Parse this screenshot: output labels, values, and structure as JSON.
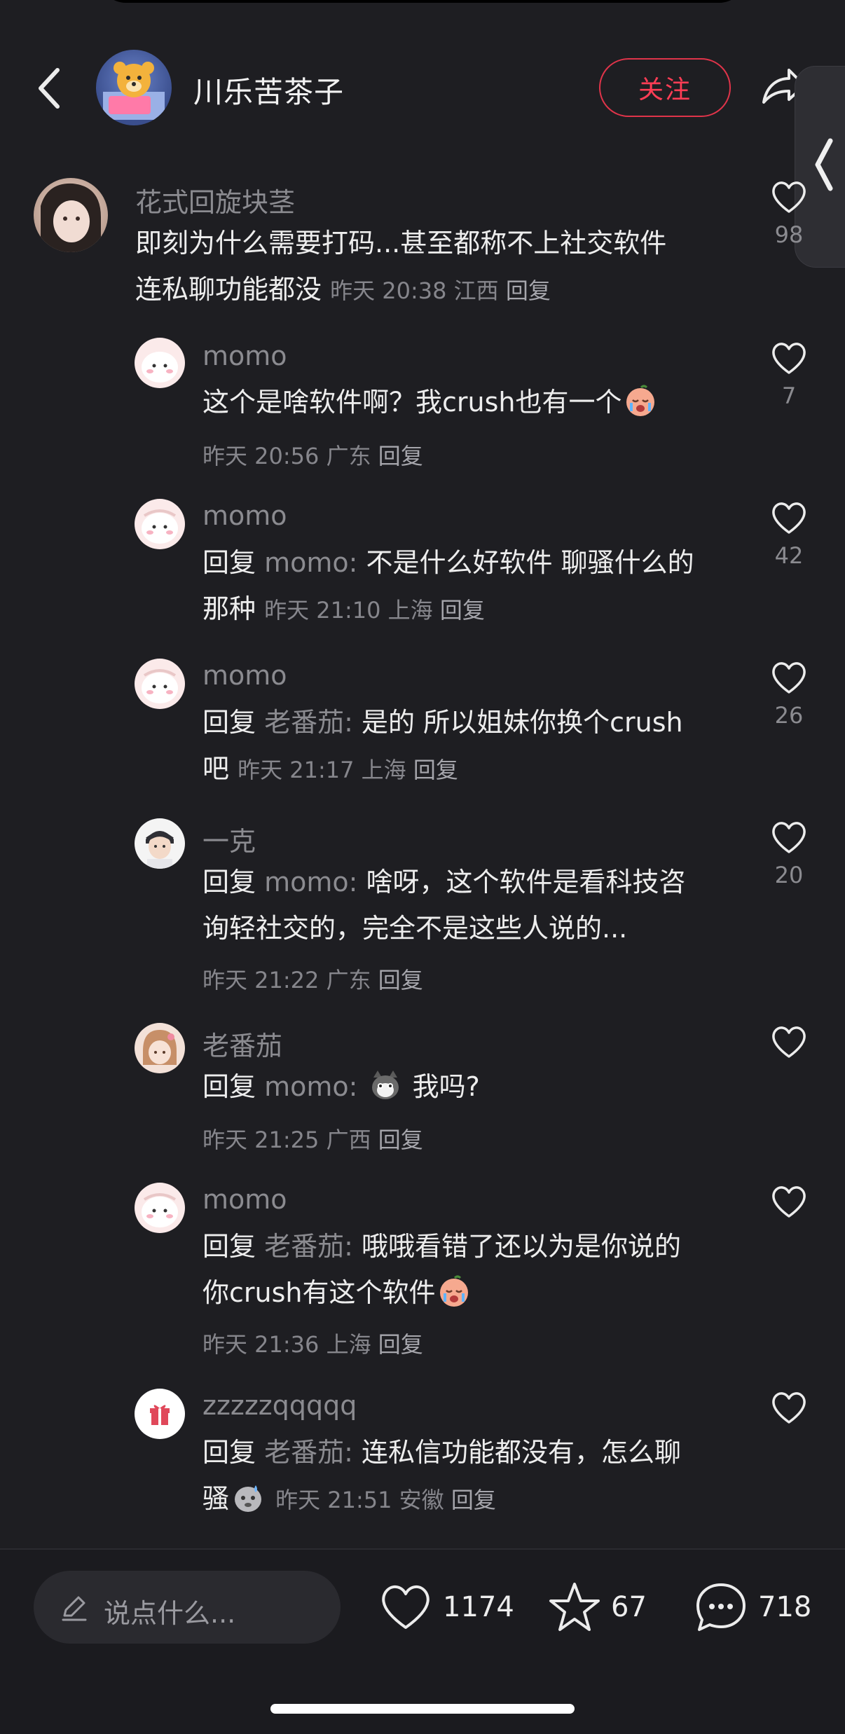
{
  "header": {
    "author_name": "川乐苦茶子",
    "follow_label": "关注"
  },
  "comments": [
    {
      "user": "花式回旋块茎",
      "line1": "即刻为什么需要打码...甚至都称不上社交软件",
      "line2": "连私聊功能都没",
      "meta": "昨天 20:38 江西",
      "reply": "回复",
      "likes": "98"
    },
    {
      "user": "momo",
      "text": "这个是啥软件啊？我crush也有一个",
      "meta": "昨天 20:56 广东",
      "reply": "回复",
      "likes": "7"
    },
    {
      "user": "momo",
      "prefix": "回复",
      "mention": "momo:",
      "line1": "不是什么好软件 聊骚什么的",
      "line2": "那种",
      "meta": "昨天 21:10 上海",
      "reply": "回复",
      "likes": "42"
    },
    {
      "user": "momo",
      "prefix": "回复",
      "mention": "老番茄:",
      "line1": "是的 所以姐妹你换个crush",
      "line2": "吧",
      "meta": "昨天 21:17 上海",
      "reply": "回复",
      "likes": "26"
    },
    {
      "user": "一克",
      "prefix": "回复",
      "mention": "momo:",
      "line1": "啥呀，这个软件是看科技咨",
      "line2": "询轻社交的，完全不是这些人说的...",
      "meta": "昨天 21:22 广东",
      "reply": "回复",
      "likes": "20"
    },
    {
      "user": "老番茄",
      "prefix": "回复",
      "mention": "momo:",
      "line1": "我吗?",
      "meta": "昨天 21:25 广西",
      "reply": "回复",
      "likes": ""
    },
    {
      "user": "momo",
      "prefix": "回复",
      "mention": "老番茄:",
      "line1": "哦哦看错了还以为是你说的",
      "line2": "你crush有这个软件",
      "meta": "昨天 21:36 上海",
      "reply": "回复",
      "likes": ""
    },
    {
      "user": "zzzzzqqqqq",
      "prefix": "回复",
      "mention": "老番茄:",
      "line1": "连私信功能都没有，怎么聊",
      "line2": "骚",
      "meta": "昨天 21:51 安徽",
      "reply": "回复",
      "likes": ""
    }
  ],
  "bottom": {
    "input_placeholder": "说点什么...",
    "likes": "1174",
    "favorites": "67",
    "comments": "718"
  },
  "colors": {
    "background": "#1e1e22",
    "accent": "#ff3d55",
    "muted": "#8b8b90"
  }
}
